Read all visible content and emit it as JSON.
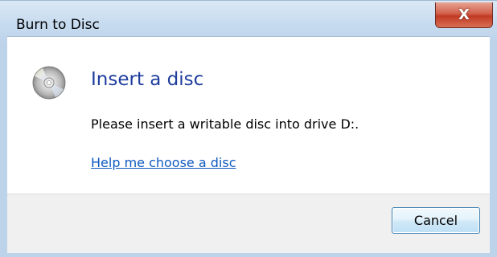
{
  "window": {
    "title": "Burn to Disc",
    "close_label": "X"
  },
  "content": {
    "heading": "Insert a disc",
    "message": "Please insert a writable disc into drive D:.",
    "help_link": "Help me choose a disc"
  },
  "footer": {
    "cancel_label": "Cancel"
  },
  "icons": {
    "disc": "disc-icon",
    "close": "close-icon"
  },
  "colors": {
    "heading": "#1e3d9c",
    "link": "#0f5bc0",
    "close_button": "#c13a24",
    "frame": "#bdd3ea"
  }
}
